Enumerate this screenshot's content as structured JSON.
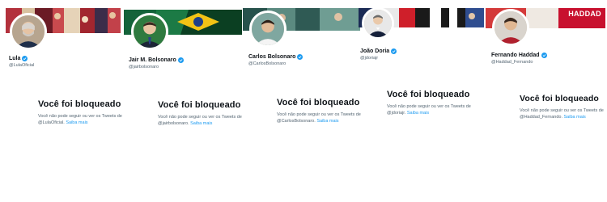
{
  "profiles": [
    {
      "name": "Lula",
      "handle": "@LulaOficial",
      "blocked_title": "Você foi bloqueado",
      "blocked_text": "Você não pode seguir ou ver os Tweets de @LulaOficial.",
      "learn_more": "Saiba mais"
    },
    {
      "name": "Jair M. Bolsonaro",
      "handle": "@jairbolsonaro",
      "blocked_title": "Você foi bloqueado",
      "blocked_text": "Você não pode seguir ou ver os Tweets de @jairbolsonaro.",
      "learn_more": "Saiba mais"
    },
    {
      "name": "Carlos Bolsonaro",
      "handle": "@CarlosBolsonaro",
      "blocked_title": "Você foi bloqueado",
      "blocked_text": "Você não pode seguir ou ver os Tweets de @CarlosBolsonaro.",
      "learn_more": "Saiba mais"
    },
    {
      "name": "João Doria",
      "handle": "@jdoriajr",
      "blocked_title": "Você foi bloqueado",
      "blocked_text": "Você não pode seguir ou ver os Tweets de @jdoriajr.",
      "learn_more": "Saiba mais"
    },
    {
      "name": "Fernando Haddad",
      "handle": "@Haddad_Fernando",
      "blocked_title": "Você foi bloqueado",
      "blocked_text": "Você não pode seguir ou ver os Tweets de @Haddad_Fernando.",
      "learn_more": "Saiba mais",
      "banner_word": "HADDAD"
    }
  ],
  "colors": {
    "verified": "#1d9bf0",
    "link": "#1d9bf0",
    "secondary_text": "#536471",
    "primary_text": "#0f1419"
  },
  "icons": {
    "verified": "verified-badge-icon"
  }
}
